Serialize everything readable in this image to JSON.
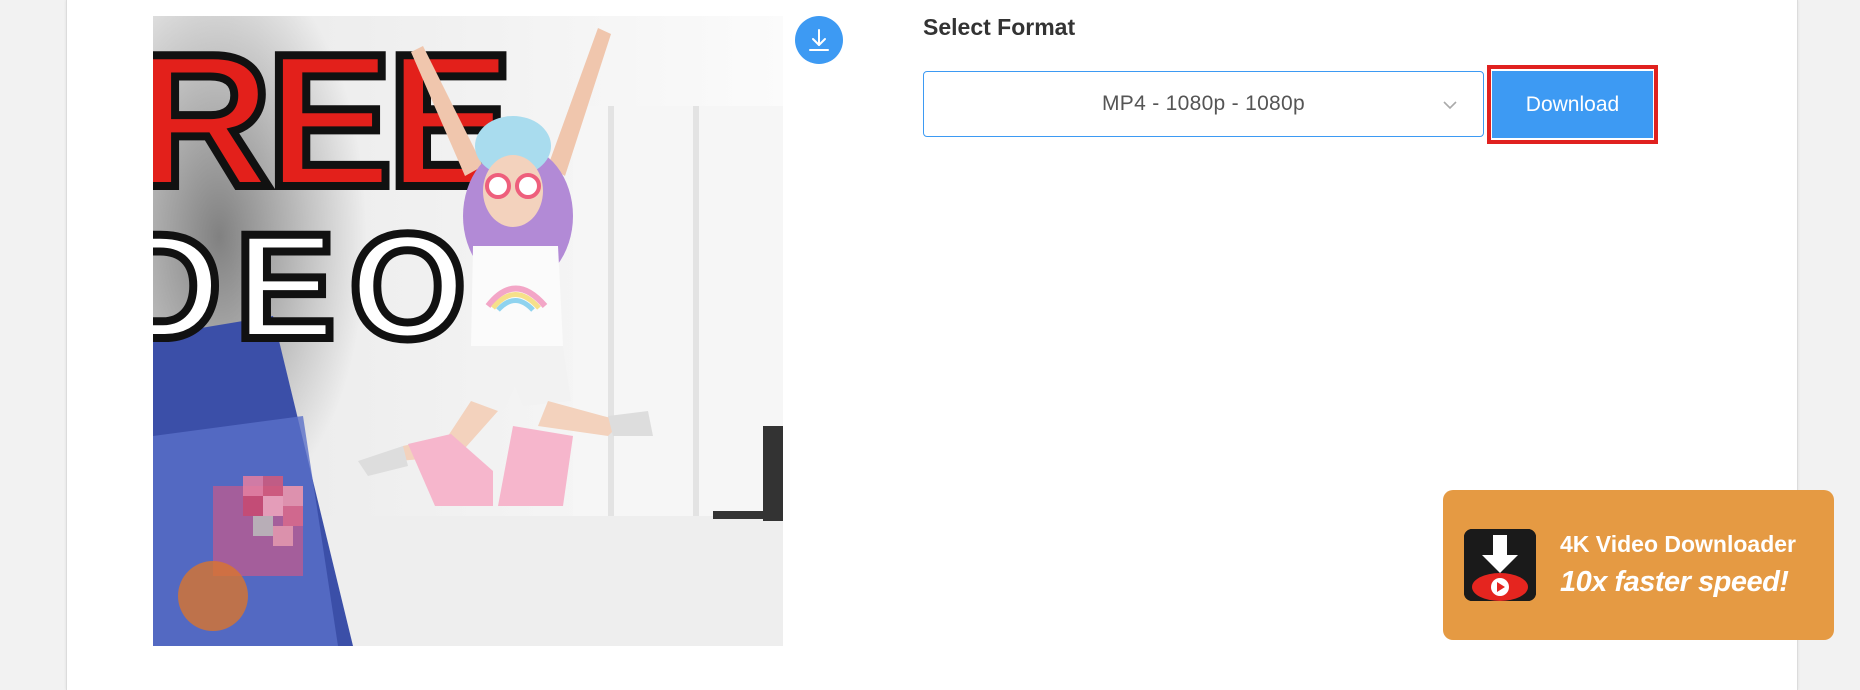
{
  "select_format": {
    "label": "Select Format",
    "selected_value": "MP4 - 1080p - 1080p"
  },
  "download_button": {
    "label": "Download"
  },
  "promo": {
    "title": "4K Video Downloader",
    "subtitle": "10x faster speed!"
  },
  "thumbnail": {
    "overlay_text_line1": "REE",
    "overlay_text_line2": "DEO"
  },
  "colors": {
    "accent": "#3d9af3",
    "highlight": "#e0211f",
    "promo_bg": "#e59a43"
  }
}
